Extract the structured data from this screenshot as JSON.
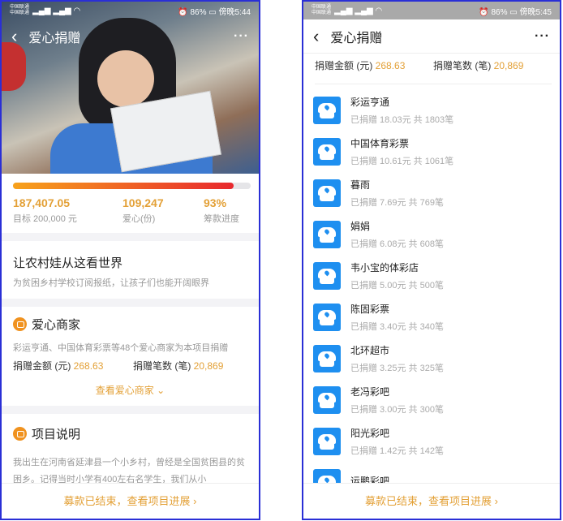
{
  "left": {
    "status": {
      "carrier1": "中国联通",
      "carrier2": "中国联通",
      "net1": "4G",
      "net2": "3G",
      "battery": "86%",
      "time": "傍晚5:44"
    },
    "nav": {
      "back_icon": "chevron-left",
      "title": "爱心捐赠",
      "more_icon": "ellipsis"
    },
    "progress": {
      "percent": 93
    },
    "stats": [
      {
        "value": "187,407.05",
        "label": "目标 200,000 元"
      },
      {
        "value": "109,247",
        "label": "爱心(份)"
      },
      {
        "value": "93%",
        "label": "筹款进度"
      }
    ],
    "project": {
      "title": "让农村娃从这看世界",
      "subtitle": "为贫困乡村学校订阅报纸，让孩子们也能开阔眼界"
    },
    "merchants": {
      "title": "爱心商家",
      "desc": "彩运亨通、中国体育彩票等48个爱心商家为本项目捐赠",
      "amount_label": "捐赠金额 (元)",
      "amount": "268.63",
      "count_label": "捐赠笔数 (笔)",
      "count": "20,869",
      "view_link": "查看爱心商家 ⌄"
    },
    "description": {
      "title": "项目说明",
      "text": "我出生在河南省延津县一个小乡村，曾经是全国贫困县的贫困乡。记得当时小学有400左右名学生，我们从小"
    },
    "bottom_link": "募款已结束，查看项目进展 ›"
  },
  "right": {
    "status": {
      "carrier1": "中国联通",
      "carrier2": "中国联通",
      "battery": "86%",
      "time": "傍晚5:45"
    },
    "nav": {
      "title": "爱心捐赠"
    },
    "summary": {
      "amount_label": "捐赠金额 (元)",
      "amount": "268.63",
      "count_label": "捐赠笔数 (笔)",
      "count": "20,869"
    },
    "merchants": [
      {
        "name": "彩运亨通",
        "detail": "已捐赠 18.03元  共 1803笔"
      },
      {
        "name": "中国体育彩票",
        "detail": "已捐赠 10.61元  共 1061笔"
      },
      {
        "name": "暮雨",
        "detail": "已捐赠 7.69元  共 769笔"
      },
      {
        "name": "娟娟",
        "detail": "已捐赠 6.08元  共 608笔"
      },
      {
        "name": "韦小宝的体彩店",
        "detail": "已捐赠 5.00元  共 500笔"
      },
      {
        "name": "陈固彩票",
        "detail": "已捐赠 3.40元  共 340笔"
      },
      {
        "name": "北环超市",
        "detail": "已捐赠 3.25元  共 325笔"
      },
      {
        "name": "老冯彩吧",
        "detail": "已捐赠 3.00元  共 300笔"
      },
      {
        "name": "阳光彩吧",
        "detail": "已捐赠 1.42元  共 142笔"
      },
      {
        "name": "运鹏彩吧",
        "detail": ""
      }
    ],
    "bottom_link": "募款已结束，查看项目进展 ›"
  },
  "colors": {
    "accent": "#e3a036",
    "progress_start": "#f7a21b",
    "progress_end": "#e8282e",
    "merchant_icon": "#1e8ff0"
  }
}
